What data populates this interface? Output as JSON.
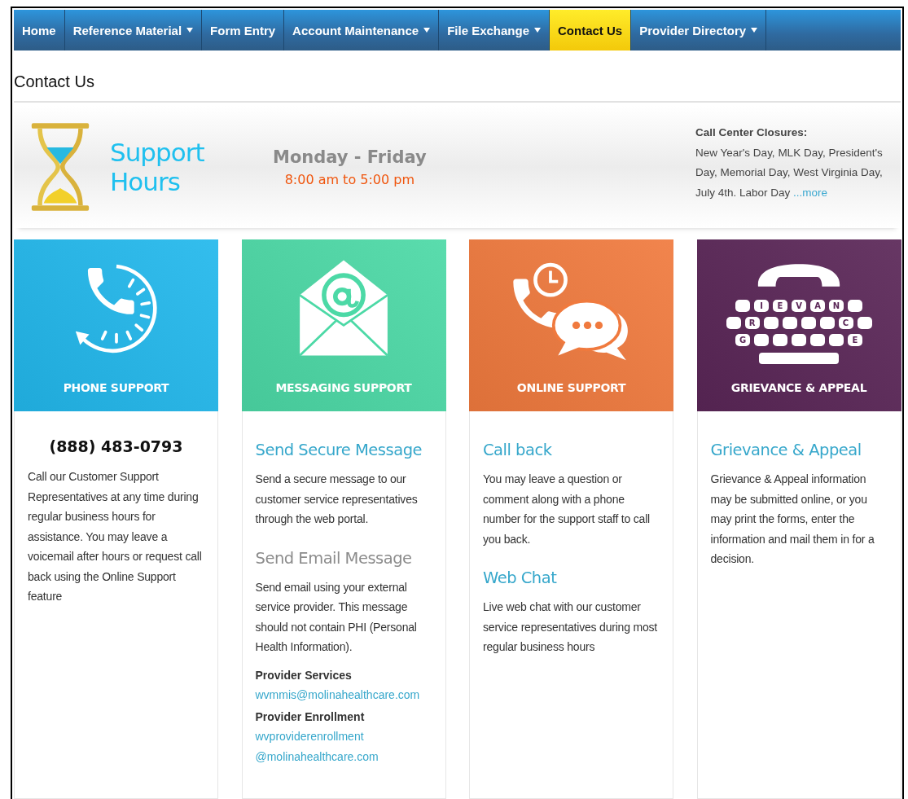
{
  "nav": {
    "items": [
      {
        "label": "Home",
        "dropdown": false,
        "selected": false
      },
      {
        "label": "Reference Material",
        "dropdown": true,
        "selected": false
      },
      {
        "label": "Form Entry",
        "dropdown": false,
        "selected": false
      },
      {
        "label": "Account Maintenance",
        "dropdown": true,
        "selected": false
      },
      {
        "label": "File Exchange",
        "dropdown": true,
        "selected": false
      },
      {
        "label": "Contact Us",
        "dropdown": false,
        "selected": true
      },
      {
        "label": "Provider Directory",
        "dropdown": true,
        "selected": false
      }
    ]
  },
  "page_title": "Contact Us",
  "banner": {
    "title": "Support Hours",
    "days": "Monday - Friday",
    "hours": "8:00 am to 5:00 pm",
    "closures_heading": "Call Center Closures:",
    "closures_text": "New Year's Day, MLK Day, President's Day, Memorial Day, West Virginia Day, July 4th. Labor Day",
    "more_link": "...more"
  },
  "cards": [
    {
      "kind": "phone",
      "label": "PHONE SUPPORT",
      "color": "#22b8ec",
      "blocks": [
        {
          "kind": "phone",
          "text": "(888) 483-0793"
        },
        {
          "kind": "text",
          "text": "Call our Customer Support Representatives at any time during regular business hours for assistance. You may leave a voicemail after hours or request call back using the Online Support feature"
        }
      ]
    },
    {
      "kind": "messaging",
      "label": "MESSAGING SUPPORT",
      "color": "#4cd9a6",
      "blocks": [
        {
          "kind": "link-heading",
          "text": "Send Secure Message"
        },
        {
          "kind": "text",
          "text": "Send a secure message to our customer service representatives through the web portal."
        },
        {
          "kind": "heading",
          "text": "Send Email Message"
        },
        {
          "kind": "text",
          "text": "Send email using your external service provider. This message should not contain PHI (Personal Health Information)."
        },
        {
          "kind": "label",
          "text": "Provider Services"
        },
        {
          "kind": "email",
          "text": "wvmmis@molinahealthcare.com"
        },
        {
          "kind": "label",
          "text": "Provider Enrollment"
        },
        {
          "kind": "email",
          "text": "wvproviderenrollment@molinahealthcare.com"
        }
      ]
    },
    {
      "kind": "online",
      "label": "ONLINE SUPPORT",
      "color": "#f07a3e",
      "blocks": [
        {
          "kind": "link-heading",
          "text": "Call back"
        },
        {
          "kind": "text",
          "text": "You may leave a question or comment along with a phone number for the support staff to call you back."
        },
        {
          "kind": "link-heading",
          "text": "Web Chat"
        },
        {
          "kind": "text",
          "text": "Live web chat with our customer service representatives during most regular business hours"
        }
      ]
    },
    {
      "kind": "grievance",
      "label": "GRIEVANCE & APPEAL",
      "color": "#5a2657",
      "keyboard": [
        [
          {
            "kind": "blank"
          },
          {
            "kind": "letter",
            "letter": "I"
          },
          {
            "kind": "letter",
            "letter": "E"
          },
          {
            "kind": "letter",
            "letter": "V"
          },
          {
            "kind": "letter",
            "letter": "A"
          },
          {
            "kind": "letter",
            "letter": "N"
          },
          {
            "kind": "blank"
          }
        ],
        [
          {
            "kind": "blank"
          },
          {
            "kind": "letter",
            "letter": "R"
          },
          {
            "kind": "blank"
          },
          {
            "kind": "blank"
          },
          {
            "kind": "blank"
          },
          {
            "kind": "blank"
          },
          {
            "kind": "letter",
            "letter": "C"
          },
          {
            "kind": "blank"
          }
        ],
        [
          {
            "kind": "letter",
            "letter": "G"
          },
          {
            "kind": "blank"
          },
          {
            "kind": "blank"
          },
          {
            "kind": "blank"
          },
          {
            "kind": "blank"
          },
          {
            "kind": "blank"
          },
          {
            "kind": "letter",
            "letter": "E"
          }
        ]
      ],
      "blocks": [
        {
          "kind": "link-heading",
          "text": "Grievance & Appeal"
        },
        {
          "kind": "text",
          "text": "Grievance & Appeal information may be submitted online, or you may print the forms, enter the information and mail them in for a decision."
        }
      ]
    }
  ]
}
